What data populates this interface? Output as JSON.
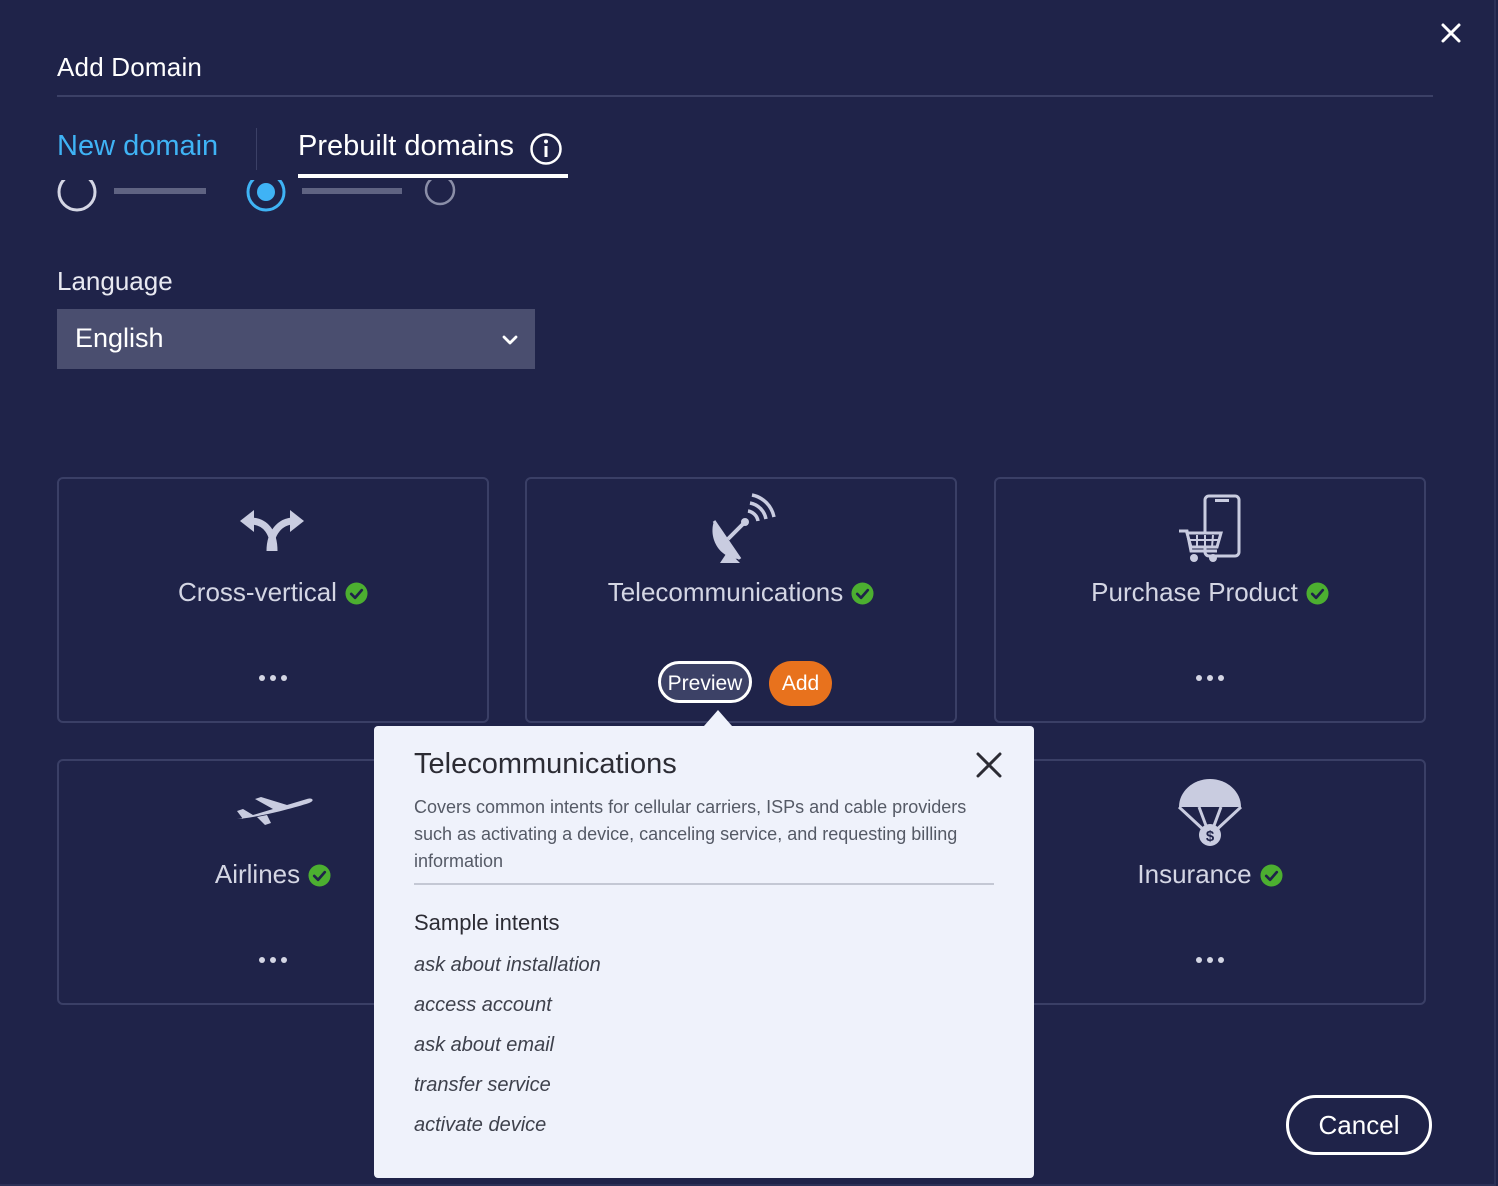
{
  "dialog": {
    "title": "Add Domain",
    "close_icon": "close-icon"
  },
  "tabs": [
    {
      "label": "New domain",
      "active": false
    },
    {
      "label": "Prebuilt domains",
      "active": true
    }
  ],
  "language": {
    "label": "Language",
    "value": "English"
  },
  "domains": [
    {
      "name": "Cross-vertical",
      "icon": "curved-arrows-icon",
      "added": true
    },
    {
      "name": "Telecommunications",
      "icon": "satellite-dish-icon",
      "added": true,
      "preview_label": "Preview",
      "add_label": "Add"
    },
    {
      "name": "Purchase Product",
      "icon": "phone-cart-icon",
      "added": true
    },
    {
      "name": "Airlines",
      "icon": "airplane-icon",
      "added": true
    },
    {
      "name": "Insurance",
      "icon": "parachute-dollar-icon",
      "added": true
    }
  ],
  "popover": {
    "title": "Telecommunications",
    "description": "Covers common intents for cellular carriers, ISPs and cable providers such as activating a device, canceling service, and requesting billing information",
    "sample_heading": "Sample intents",
    "samples": [
      "ask about installation",
      "access account",
      "ask about email",
      "transfer service",
      "activate device"
    ]
  },
  "footer": {
    "cancel_label": "Cancel"
  },
  "colors": {
    "background": "#1f2349",
    "accent_blue": "#3fb3f5",
    "add_orange": "#e8721d",
    "check_green": "#4caf30"
  }
}
